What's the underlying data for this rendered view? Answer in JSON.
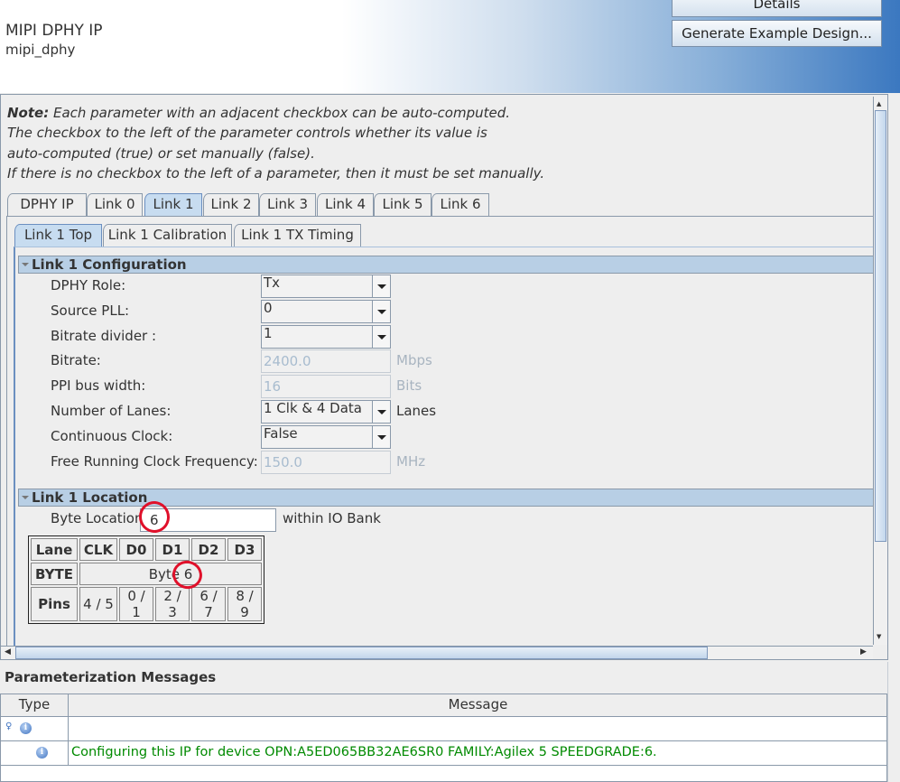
{
  "header": {
    "title": "MIPI DPHY IP",
    "subtitle": "mipi_dphy",
    "details_button": "Details",
    "generate_button": "Generate Example Design..."
  },
  "note": {
    "bold": "Note:",
    "line1": " Each parameter with an adjacent checkbox can be auto-computed.",
    "line2": "The checkbox to the left of the parameter controls whether its value is",
    "line3": "auto-computed (true) or set manually (false).",
    "line4": "If there is no checkbox to the left of a parameter, then it must be set manually."
  },
  "tabs": [
    "DPHY IP",
    "Link 0",
    "Link 1",
    "Link 2",
    "Link 3",
    "Link 4",
    "Link 5",
    "Link 6"
  ],
  "selected_tab": "Link 1",
  "subtabs": [
    "Link 1 Top",
    "Link 1 Calibration",
    "Link 1 TX Timing"
  ],
  "selected_subtab": "Link 1 Top",
  "config": {
    "title": "Link 1 Configuration",
    "params": [
      {
        "label": "DPHY Role:",
        "value": "Tx",
        "type": "dropdown"
      },
      {
        "label": "Source PLL:",
        "value": "0",
        "type": "dropdown"
      },
      {
        "label": "Bitrate divider :",
        "value": "1",
        "type": "dropdown"
      },
      {
        "label": "Bitrate:",
        "value": "2400.0",
        "type": "disabled",
        "unit": "Mbps"
      },
      {
        "label": "PPI bus width:",
        "value": "16",
        "type": "disabled",
        "unit": "Bits"
      },
      {
        "label": "Number of Lanes:",
        "value": "1 Clk & 4 Data",
        "type": "dropdown",
        "unit": "Lanes"
      },
      {
        "label": "Continuous Clock:",
        "value": "False",
        "type": "dropdown"
      },
      {
        "label": "Free Running Clock Frequency:",
        "value": "150.0",
        "type": "disabled",
        "unit": "MHz"
      }
    ]
  },
  "location": {
    "title": "Link 1 Location",
    "byte_label": "Byte Location",
    "byte_value": "6",
    "suffix": "within IO Bank",
    "table": {
      "lane_header": "Lane",
      "lanes": [
        "CLK",
        "D0",
        "D1",
        "D2",
        "D3"
      ],
      "byte_header": "BYTE",
      "byte_value": "Byte 6",
      "pins_header": "Pins",
      "pins": [
        "4 / 5",
        "0 / 1",
        "2 / 3",
        "6 / 7",
        "8 / 9"
      ]
    }
  },
  "messages": {
    "title": "Parameterization Messages",
    "col_type": "Type",
    "col_message": "Message",
    "rows": [
      {
        "message": ""
      },
      {
        "message": "Configuring this IP for device OPN:A5ED065BB32AE6SR0 FAMILY:Agilex 5 SPEEDGRADE:6."
      }
    ],
    "message_color": "#008a00"
  },
  "colors": {
    "annotation": "#e0102a",
    "section_header": "#b8cfe5"
  }
}
